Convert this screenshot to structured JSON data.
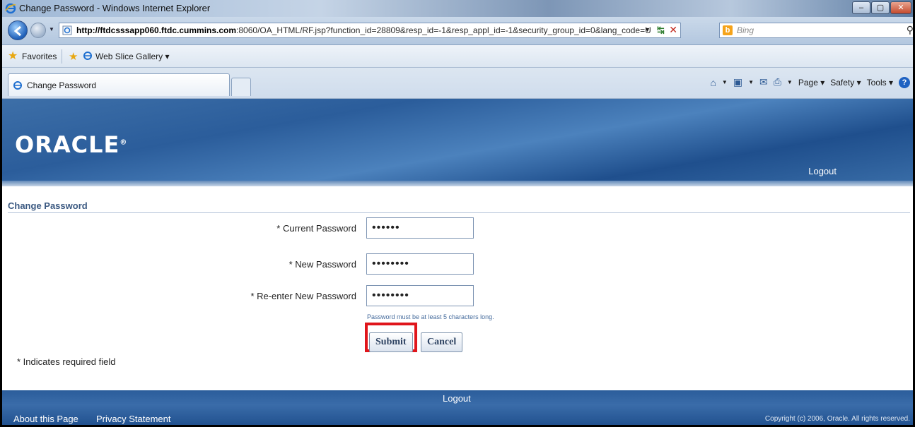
{
  "window": {
    "title": "Change Password - Windows Internet Explorer"
  },
  "address_bar": {
    "url_host": "http://ftdcsssapp060.ftdc.cummins.com",
    "url_rest": ":8060/OA_HTML/RF.jsp?function_id=28809&resp_id=-1&resp_appl_id=-1&security_group_id=0&lang_code=U"
  },
  "search": {
    "placeholder": "Bing"
  },
  "favorites_bar": {
    "favorites_label": "Favorites",
    "web_slice_label": "Web Slice Gallery ▾"
  },
  "tab": {
    "label": "Change Password"
  },
  "command_bar": {
    "page_label": "Page ▾",
    "safety_label": "Safety ▾",
    "tools_label": "Tools ▾"
  },
  "oracle_header": {
    "logo_text": "ORACLE",
    "logo_mark": "®",
    "logout_label": "Logout"
  },
  "form": {
    "section_title": "Change Password",
    "fields": [
      {
        "label": "* Current Password",
        "value": "••••••"
      },
      {
        "label": "* New Password",
        "value": "••••••••"
      },
      {
        "label": "* Re-enter New Password",
        "value": "••••••••"
      }
    ],
    "hint": "Password must be at least 5 characters long.",
    "submit_label": "Submit",
    "cancel_label": "Cancel",
    "required_note": "*  Indicates required field"
  },
  "footer": {
    "logout_label": "Logout",
    "about_label": "About this Page",
    "privacy_label": "Privacy Statement",
    "copyright": "Copyright (c) 2006, Oracle. All rights reserved."
  },
  "colors": {
    "oracle_blue": "#2b5d9b",
    "section_title": "#3c5a82",
    "highlight_red": "#e0151b"
  }
}
